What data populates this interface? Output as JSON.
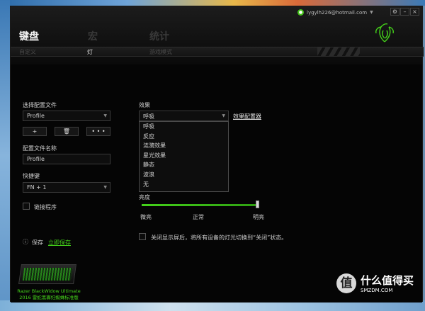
{
  "window": {
    "account_email": "lygylh226@hotmail.com",
    "account_icon": "user-icon"
  },
  "nav": {
    "tabs": [
      "键盘",
      "宏",
      "统计"
    ],
    "subtabs": [
      "自定义",
      "灯",
      "游戏模式"
    ]
  },
  "left_panel": {
    "select_profile_label": "选择配置文件",
    "profile_value": "Profile",
    "btn_add": "+",
    "btn_delete": "🗑",
    "btn_more": "• • •",
    "profile_name_label": "配置文件名称",
    "profile_name_value": "Profile",
    "shortcut_label": "快捷键",
    "shortcut_value": "FN + 1",
    "link_program_label": "链接程序",
    "save_label": "保存",
    "save_now_link": "立即保存"
  },
  "effects": {
    "label": "效果",
    "selected": "呼吸",
    "configurator_link": "效果配置器",
    "options": [
      "呼吸",
      "反应",
      "涟漪效果",
      "星光效果",
      "静态",
      "波浪",
      "无"
    ]
  },
  "brightness": {
    "label": "亮度",
    "value_fraction": 1.0,
    "low_label": "微亮",
    "mid_label": "正常",
    "high_label": "明亮"
  },
  "screen_off_option": "关闭显示屏后，将所有设备的灯光切换到“关闭”状态。",
  "device": {
    "caption_line1": "Razer BlackWidow Ultimate",
    "caption_line2": "2016 雷蛇黑寡妇蜘蛛标准版"
  },
  "watermark": {
    "badge": "值",
    "cn": "什么值得买",
    "en": "SMZDM.COM"
  },
  "colors": {
    "accent": "#44d21a",
    "background": "#050505"
  }
}
